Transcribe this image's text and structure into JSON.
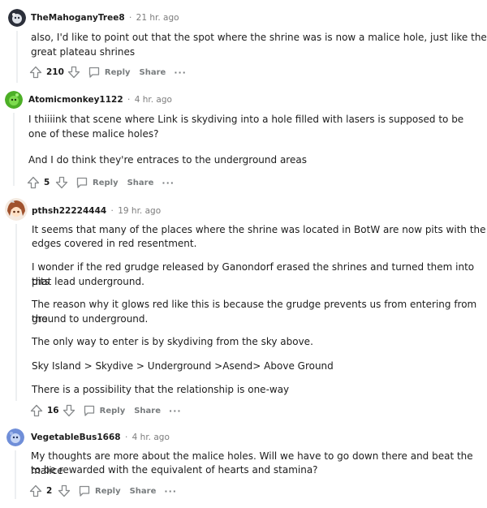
{
  "comments": [
    {
      "username": "TheMahoganyTree8",
      "separator": "·",
      "time": "21 hr. ago",
      "avatar": "snoo-avatar-dark",
      "paragraphs": [
        "also, I'd like to point out that the spot where the shrine was is now a malice hole, just like the",
        "great plateau shrines"
      ],
      "score": "210",
      "reply_label": "Reply",
      "share_label": "Share",
      "more_label": "···"
    },
    {
      "username": "Atomicmonkey1122",
      "separator": "·",
      "time": "4 hr. ago",
      "avatar": "snoo-avatar-green",
      "paragraphs": [
        "I thiiiink that scene where Link is skydiving into a hole filled with lasers is supposed to be",
        "one of these malice holes?",
        "And I do think they're entraces to the underground areas"
      ],
      "score": "5",
      "reply_label": "Reply",
      "share_label": "Share",
      "more_label": "···"
    },
    {
      "username": "pthsh22224444",
      "separator": "·",
      "time": "19 hr. ago",
      "avatar": "anime-avatar",
      "paragraphs": [
        "It seems that many of the places where the shrine was located in BotW are now pits with the",
        "edges covered in red resentment.",
        "I wonder if the red grudge released by Ganondorf erased the shrines and turned them into pits",
        "that lead underground.",
        "The reason why it glows red like this is because the grudge prevents us from entering from the",
        "ground to underground.",
        "The only way to enter is by skydiving from the sky above.",
        "Sky Island > Skydive > Underground >Asend> Above Ground",
        "There is a possibility that the relationship is one-way"
      ],
      "score": "16",
      "reply_label": "Reply",
      "share_label": "Share",
      "more_label": "···"
    },
    {
      "username": "VegetableBus1668",
      "separator": "·",
      "time": "4 hr. ago",
      "avatar": "snoo-avatar-blue",
      "paragraphs": [
        "My thoughts are more about the malice holes. Will we have to go down there and beat the malice",
        "to be rewarded with the equivalent of hearts and stamina?"
      ],
      "score": "2",
      "reply_label": "Reply",
      "share_label": "Share",
      "more_label": "···"
    }
  ],
  "colors": {
    "meta_gray": "#7c7c7c",
    "action_gray": "#787c7e",
    "text": "#1c1c1c",
    "thread_line": "#edeff1"
  }
}
